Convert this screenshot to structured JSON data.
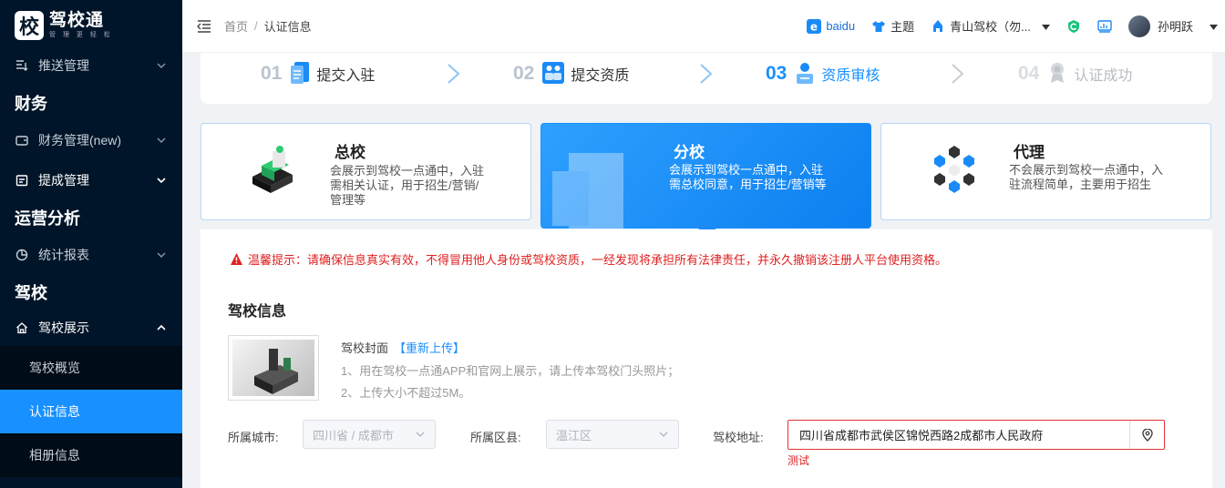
{
  "sidebar": {
    "logo_char": "校",
    "logo_title": "驾校通",
    "logo_sub": "管 理 更 轻 松",
    "items": [
      {
        "type": "item",
        "label": "推送管理",
        "icon": "push-list-icon"
      },
      {
        "type": "group",
        "label": "财务"
      },
      {
        "type": "item",
        "label": "财务管理(new)",
        "icon": "wallet-icon"
      },
      {
        "type": "item",
        "label": "提成管理",
        "icon": "calendar-icon"
      },
      {
        "type": "group",
        "label": "运营分析"
      },
      {
        "type": "item",
        "label": "统计报表",
        "icon": "pie-chart-icon"
      },
      {
        "type": "group",
        "label": "驾校"
      },
      {
        "type": "item",
        "label": "驾校展示",
        "icon": "home-icon"
      }
    ],
    "sub_items": [
      "驾校概览",
      "认证信息",
      "相册信息"
    ],
    "active_sub": "认证信息"
  },
  "header": {
    "breadcrumb_home": "首页",
    "breadcrumb_sep": "/",
    "breadcrumb_current": "认证信息",
    "baidu": "baidu",
    "theme": "主题",
    "school": "青山驾校（勿...",
    "user": "孙明跃"
  },
  "steps": [
    {
      "num": "01",
      "label": "提交入驻",
      "state": "done"
    },
    {
      "num": "02",
      "label": "提交资质",
      "state": "done"
    },
    {
      "num": "03",
      "label": "资质审核",
      "state": "active"
    },
    {
      "num": "04",
      "label": "认证成功",
      "state": "disabled"
    }
  ],
  "cards": [
    {
      "title": "总校",
      "desc_lines": [
        "会展示到驾校一点通中，入驻",
        "需相关认证，用于招生/营销/",
        "管理等"
      ]
    },
    {
      "title": "分校",
      "desc_lines": [
        "会展示到驾校一点通中，入驻",
        "需总校同意，用于招生/营销等"
      ]
    },
    {
      "title": "代理",
      "desc_lines": [
        "不会展示到驾校一点通中，入",
        "驻流程简单，主要用于招生"
      ]
    }
  ],
  "form": {
    "warning": "温馨提示：请确保信息真实有效，不得冒用他人身份或驾校资质，一经发现将承担所有法律责任，并永久撤销该注册人平台使用资格。",
    "section_title": "驾校信息",
    "cover_label": "驾校封面",
    "cover_link": "【重新上传】",
    "cover_tip1": "1、用在驾校一点通APP和官网上展示，请上传本驾校门头照片；",
    "cover_tip2": "2、上传大小不超过5M。",
    "city_label": "所属城市:",
    "city_value": "四川省 / 成都市",
    "district_label": "所属区县:",
    "district_value": "温江区",
    "address_label": "驾校地址:",
    "address_value": "四川省成都市武侯区锦悦西路2成都市人民政府",
    "address_error": "测试"
  },
  "colors": {
    "primary": "#1890ff",
    "sidebar_bg": "#001529",
    "error": "#e02020"
  }
}
